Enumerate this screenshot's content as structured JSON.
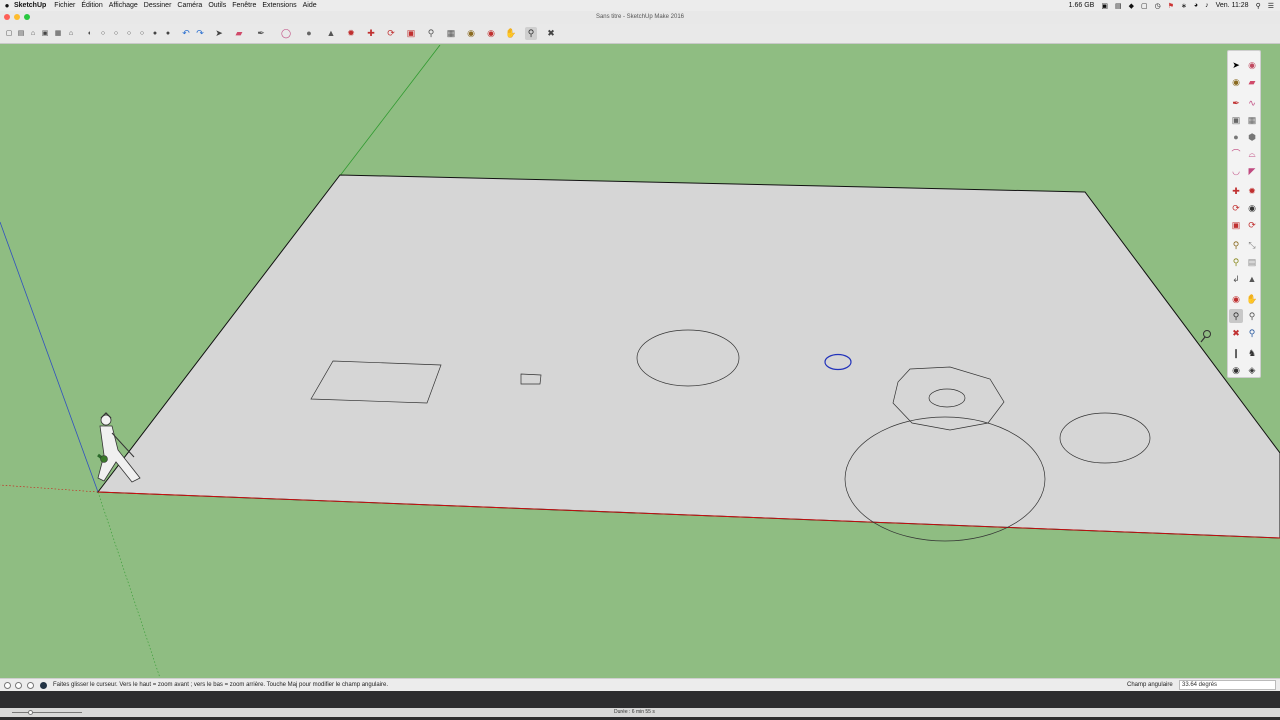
{
  "menubar": {
    "apple_icon": "",
    "app_name": "SketchUp",
    "items": [
      "Fichier",
      "Édition",
      "Affichage",
      "Dessiner",
      "Caméra",
      "Outils",
      "Fenêtre",
      "Extensions",
      "Aide"
    ],
    "memory": "1.66 GB",
    "clock": "Ven. 11:28"
  },
  "window": {
    "title": "Sans titre - SketchUp Make 2016"
  },
  "toolbar_icons": [
    "new-icon",
    "open-icon",
    "save-icon",
    "home-icon",
    "warehouse-icon",
    "extension-warehouse-icon",
    "xray-style-icon",
    "wireframe-style-icon",
    "hidden-line-style-icon",
    "shaded-style-icon",
    "textured-style-icon",
    "monochrome-style-icon",
    "undo-icon",
    "redo-icon",
    "select-icon",
    "eraser-icon",
    "line-icon",
    "arc-icon",
    "shape-icon",
    "pushpull-icon",
    "followme-icon",
    "move-icon",
    "rotate-icon",
    "scale-icon",
    "tape-measure-icon",
    "dimension-icon",
    "paint-bucket-icon",
    "orbit-icon",
    "pan-icon",
    "zoom-icon",
    "zoom-extents-icon"
  ],
  "statusbar": {
    "hint": "Faites glisser le curseur. Vers le haut = zoom avant ; vers le bas = zoom arrière. Touche Maj pour modifier le champ angulaire.",
    "vcb_label": "Champ angulaire",
    "vcb_value": "33.64 degrés"
  },
  "video": {
    "duration": "Durée : 6 min 55 s"
  },
  "colors": {
    "background": "#8fbd82",
    "ground_plane": "#d6d6d6",
    "selected_circle": "#2233bb",
    "red_axis": "#d01010",
    "green_axis": "#2f9a2f",
    "blue_axis": "#3050c0"
  }
}
